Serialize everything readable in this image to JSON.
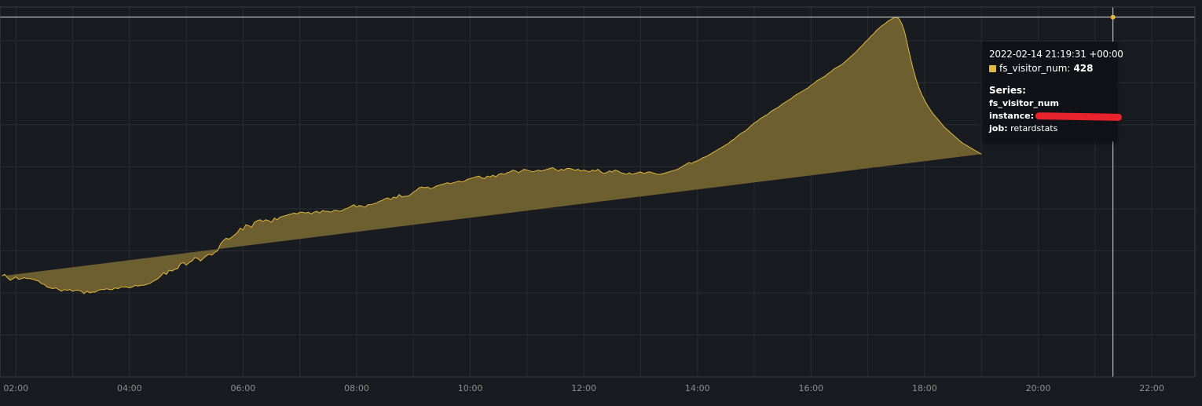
{
  "colors": {
    "background": "#181b1f",
    "grid": "#2a2d33",
    "series_line": "#e0b83c",
    "series_fill": "#6e5f30",
    "crosshair": "#d8d9da",
    "tooltip_bg": "#111217",
    "redaction": "#e8232b"
  },
  "tooltip": {
    "time": "2022-02-14 21:19:31 +00:00",
    "series_name": "fs_visitor_num",
    "value": "428",
    "series_heading": "Series:",
    "metric_name": "fs_visitor_num",
    "instance_key": "instance:",
    "job_key": "job:",
    "job_value": "retardstats"
  },
  "chart_data": {
    "type": "area",
    "series": [
      {
        "name": "fs_visitor_num",
        "hours": [
          1.75,
          1.8,
          1.85,
          1.9,
          1.95,
          2.0,
          2.05,
          2.1,
          2.15,
          2.2,
          2.25,
          2.3,
          2.35,
          2.4,
          2.45,
          2.5,
          2.55,
          2.6,
          2.65,
          2.7,
          2.75,
          2.8,
          2.85,
          2.9,
          2.95,
          3.0,
          3.05,
          3.1,
          3.15,
          3.2,
          3.25,
          3.3,
          3.35,
          3.4,
          3.45,
          3.5,
          3.55,
          3.6,
          3.65,
          3.7,
          3.75,
          3.8,
          3.85,
          3.9,
          3.95,
          4.0,
          4.05,
          4.1,
          4.15,
          4.2,
          4.25,
          4.3,
          4.35,
          4.4,
          4.45,
          4.5,
          4.55,
          4.6,
          4.65,
          4.7,
          4.75,
          4.8,
          4.85,
          4.9,
          4.95,
          5.0,
          5.05,
          5.1,
          5.15,
          5.2,
          5.25,
          5.3,
          5.35,
          5.4,
          5.45,
          5.5,
          5.55,
          5.6,
          5.65,
          5.7,
          5.75,
          5.8,
          5.85,
          5.9,
          5.95,
          6.0,
          6.05,
          6.1,
          6.15,
          6.2,
          6.25,
          6.3,
          6.35,
          6.4,
          6.45,
          6.5,
          6.55,
          6.6,
          6.65,
          6.7,
          6.75,
          6.8,
          6.85,
          6.9,
          6.95,
          7.0,
          7.05,
          7.1,
          7.15,
          7.2,
          7.25,
          7.3,
          7.35,
          7.4,
          7.45,
          7.5,
          7.55,
          7.6,
          7.65,
          7.7,
          7.75,
          7.8,
          7.85,
          7.9,
          7.95,
          8.0,
          8.05,
          8.1,
          8.15,
          8.2,
          8.25,
          8.3,
          8.35,
          8.4,
          8.45,
          8.5,
          8.55,
          8.6,
          8.65,
          8.7,
          8.75,
          8.8,
          8.85,
          8.9,
          8.95,
          9.0,
          9.05,
          9.1,
          9.15,
          9.2,
          9.25,
          9.3,
          9.35,
          9.4,
          9.45,
          9.5,
          9.55,
          9.6,
          9.65,
          9.7,
          9.75,
          9.8,
          9.85,
          9.9,
          9.95,
          10.0,
          10.05,
          10.1,
          10.15,
          10.2,
          10.25,
          10.3,
          10.35,
          10.4,
          10.45,
          10.5,
          10.55,
          10.6,
          10.65,
          10.7,
          10.75,
          10.8,
          10.85,
          10.9,
          10.95,
          11.0,
          11.05,
          11.1,
          11.15,
          11.2,
          11.25,
          11.3,
          11.35,
          11.4,
          11.45,
          11.5,
          11.55,
          11.6,
          11.65,
          11.7,
          11.75,
          11.8,
          11.85,
          11.9,
          11.95,
          12.0,
          12.05,
          12.1,
          12.15,
          12.2,
          12.25,
          12.3,
          12.35,
          12.4,
          12.45,
          12.5,
          12.55,
          12.6,
          12.65,
          12.7,
          12.75,
          12.8,
          12.85,
          12.9,
          12.95,
          13.0,
          13.05,
          13.1,
          13.15,
          13.2,
          13.25,
          13.3,
          13.35,
          13.4,
          13.45,
          13.5,
          13.55,
          13.6,
          13.65,
          13.7,
          13.75,
          13.8,
          13.85,
          13.9,
          13.95,
          14.0,
          14.05,
          14.1,
          14.15,
          14.2,
          14.25,
          14.3,
          14.35,
          14.4,
          14.45,
          14.5,
          14.55,
          14.6,
          14.65,
          14.7,
          14.75,
          14.8,
          14.85,
          14.9,
          14.95,
          15.0,
          15.05,
          15.1,
          15.15,
          15.2,
          15.25,
          15.3,
          15.35,
          15.4,
          15.45,
          15.5,
          15.55,
          15.6,
          15.65,
          15.7,
          15.75,
          15.8,
          15.85,
          15.9,
          15.95,
          16.0,
          16.05,
          16.1,
          16.15,
          16.2,
          16.25,
          16.3,
          16.35,
          16.4,
          16.45,
          16.5,
          16.55,
          16.6,
          16.65,
          16.7,
          16.75,
          16.8,
          16.85,
          16.9,
          16.95,
          17.0,
          17.05,
          17.1,
          17.15,
          17.2,
          17.25,
          17.3,
          17.35,
          17.4,
          17.45,
          17.5,
          17.55,
          17.6,
          17.65,
          17.7,
          17.75,
          17.8,
          17.85,
          17.9,
          17.95,
          18.0,
          18.05,
          18.1,
          18.15,
          18.2,
          18.25,
          18.3,
          18.35,
          18.4,
          18.45,
          18.5,
          18.55,
          18.6,
          18.65,
          18.7,
          18.75,
          18.8,
          18.85,
          18.9,
          18.95,
          19.0,
          19.05,
          19.1,
          19.15,
          19.2,
          19.25,
          19.3,
          19.35,
          19.4,
          19.45,
          19.5,
          19.55,
          19.6,
          19.65,
          19.7,
          19.75,
          19.8,
          19.85,
          19.9,
          19.95,
          20.0,
          20.05,
          20.1,
          20.15,
          20.2,
          20.25,
          20.3,
          20.35,
          20.4,
          20.45,
          20.5,
          20.55,
          20.6,
          20.65,
          20.7,
          20.75,
          20.8,
          20.85,
          20.9,
          20.95,
          21.0,
          21.05,
          21.1,
          21.15,
          21.2,
          21.25,
          21.3,
          21.35,
          21.4,
          21.45,
          21.5,
          21.55,
          21.6,
          21.65,
          21.7,
          21.75,
          21.8,
          21.85,
          21.9,
          21.95,
          22.0,
          22.05,
          22.1,
          22.15,
          22.2,
          22.25,
          22.3,
          22.35,
          22.4,
          22.45,
          22.5,
          22.55,
          22.6,
          22.65,
          22.7,
          22.75
        ],
        "values": [
          120,
          122,
          118,
          115,
          117,
          119,
          116,
          117,
          118,
          117,
          117,
          116,
          115,
          114,
          111,
          110,
          107,
          106,
          105,
          106,
          104,
          102,
          104,
          103,
          104,
          102,
          103,
          103,
          102,
          99,
          102,
          100,
          101,
          101,
          103,
          104,
          104,
          105,
          104,
          104,
          106,
          105,
          107,
          107,
          107,
          106,
          107,
          109,
          108,
          109,
          109,
          110,
          111,
          113,
          115,
          117,
          120,
          124,
          122,
          127,
          126,
          128,
          129,
          135,
          136,
          133,
          136,
          138,
          142,
          141,
          138,
          141,
          144,
          146,
          145,
          148,
          150,
          158,
          162,
          165,
          164,
          166,
          169,
          172,
          177,
          175,
          181,
          180,
          178,
          184,
          186,
          187,
          185,
          187,
          186,
          184,
          189,
          187,
          190,
          191,
          192,
          193,
          194,
          195,
          194,
          196,
          196,
          195,
          196,
          194,
          196,
          197,
          195,
          198,
          197,
          197,
          196,
          198,
          198,
          197,
          198,
          200,
          201,
          203,
          205,
          202,
          204,
          203,
          202,
          205,
          205,
          206,
          207,
          209,
          210,
          212,
          213,
          211,
          214,
          213,
          217,
          214,
          215,
          215,
          217,
          220,
          222,
          225,
          226,
          225,
          226,
          224,
          225,
          227,
          228,
          229,
          230,
          231,
          230,
          231,
          232,
          233,
          232,
          233,
          235,
          236,
          237,
          238,
          239,
          237,
          236,
          239,
          238,
          240,
          238,
          241,
          242,
          241,
          243,
          244,
          246,
          245,
          243,
          245,
          247,
          246,
          245,
          244,
          245,
          246,
          245,
          246,
          247,
          248,
          249,
          247,
          245,
          247,
          246,
          248,
          248,
          247,
          246,
          247,
          245,
          246,
          245,
          244,
          246,
          245,
          247,
          244,
          242,
          243,
          245,
          244,
          246,
          245,
          243,
          242,
          241,
          243,
          241,
          242,
          243,
          244,
          242,
          243,
          244,
          243,
          242,
          241,
          241,
          242,
          243,
          244,
          245,
          246,
          247,
          249,
          251,
          253,
          255,
          254,
          256,
          257,
          259,
          261,
          262,
          264,
          266,
          268,
          270,
          272,
          274,
          276,
          278,
          281,
          283,
          286,
          289,
          291,
          293,
          296,
          299,
          302,
          304,
          307,
          309,
          311,
          313,
          316,
          318,
          320,
          322,
          325,
          327,
          329,
          331,
          334,
          336,
          338,
          340,
          342,
          344,
          347,
          349,
          352,
          354,
          356,
          358,
          361,
          363,
          366,
          368,
          370,
          372,
          375,
          378,
          381,
          384,
          387,
          391,
          394,
          398,
          401,
          405,
          408,
          412,
          415,
          418,
          420,
          423,
          425,
          427,
          428,
          426,
          420,
          410,
          395,
          380,
          366,
          354,
          344,
          336,
          329,
          323,
          318,
          313,
          309,
          305,
          301,
          297,
          294,
          291,
          288,
          285,
          282,
          279,
          277,
          275,
          273,
          271,
          269,
          267,
          265
        ],
        "peak_point": {
          "time": "21:19",
          "value": 428
        }
      }
    ],
    "x_tick_labels": [
      "02:00",
      "04:00",
      "06:00",
      "08:00",
      "10:00",
      "12:00",
      "14:00",
      "16:00",
      "18:00",
      "20:00",
      "22:00"
    ],
    "x_range_hours": [
      1.72,
      22.76
    ],
    "ylim": [
      0,
      440
    ],
    "grid": true,
    "legend": "none"
  }
}
